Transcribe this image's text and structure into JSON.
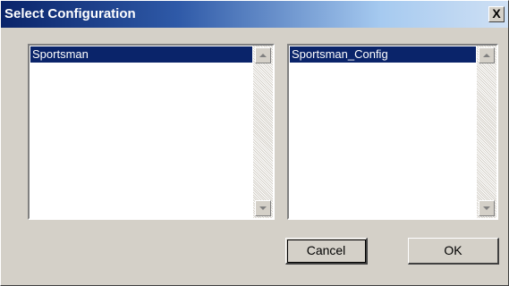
{
  "window": {
    "title": "Select Configuration",
    "close_glyph": "X"
  },
  "left_list": {
    "items": [
      "Sportsman"
    ],
    "selected_index": 0
  },
  "right_list": {
    "items": [
      "Sportsman_Config"
    ],
    "selected_index": 0
  },
  "buttons": {
    "cancel_label": "Cancel",
    "ok_label": "OK"
  },
  "colors": {
    "selection": "#0a246a",
    "title_start": "#0a246a",
    "face": "#d4d0c8"
  },
  "icons": {
    "close": "close-icon",
    "scroll_up": "scroll-up-arrow-icon",
    "scroll_down": "scroll-down-arrow-icon"
  }
}
